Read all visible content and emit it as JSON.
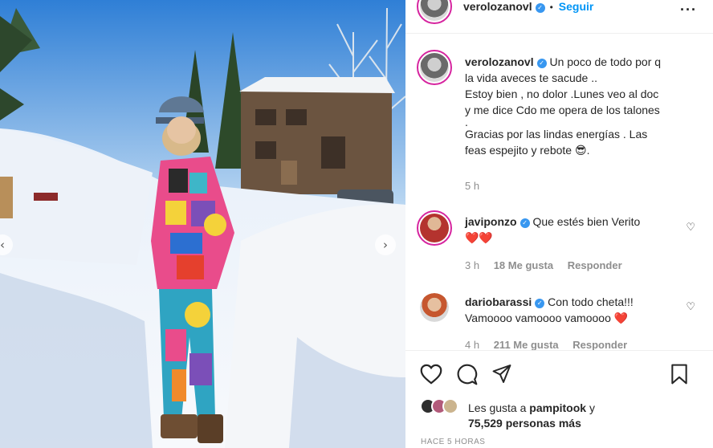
{
  "post": {
    "author": "verolozanovl",
    "follow_label": "Seguir",
    "caption_lines": [
      "Un poco de todo por q",
      "la vida aveces te sacude ..",
      "Estoy bien , no dolor .Lunes veo al doc",
      "y me dice Cdo me opera de los talones",
      ".",
      "Gracias por las lindas energías . Las",
      "feas espejito y rebote 😎."
    ],
    "caption_time": "5 h"
  },
  "comments": [
    {
      "username": "javiponzo",
      "text": "Que estés bien Verito",
      "text_line2": "❤️❤️",
      "time": "3 h",
      "likes": "18 Me gusta",
      "reply": "Responder"
    },
    {
      "username": "dariobarassi",
      "text": "Con todo cheta!!!",
      "text_line2": "Vamoooo vamoooo vamoooo ❤️",
      "time": "4 h",
      "likes": "211 Me gusta",
      "reply": "Responder"
    }
  ],
  "likes": {
    "prefix": "Les gusta a",
    "user": "pampitook",
    "connector": "y",
    "count": "75,529",
    "suffix": "personas más"
  },
  "timestamp": "HACE 5 HORAS",
  "icons": {
    "more": "more-options-icon",
    "like": "heart-icon",
    "comment": "comment-icon",
    "share": "send-icon",
    "save": "bookmark-icon",
    "verified": "verified-badge-icon"
  },
  "colors": {
    "accent": "#0095f6",
    "verified": "#3897f0",
    "heart_red": "#ed4956",
    "muted": "#8e8e8e"
  }
}
